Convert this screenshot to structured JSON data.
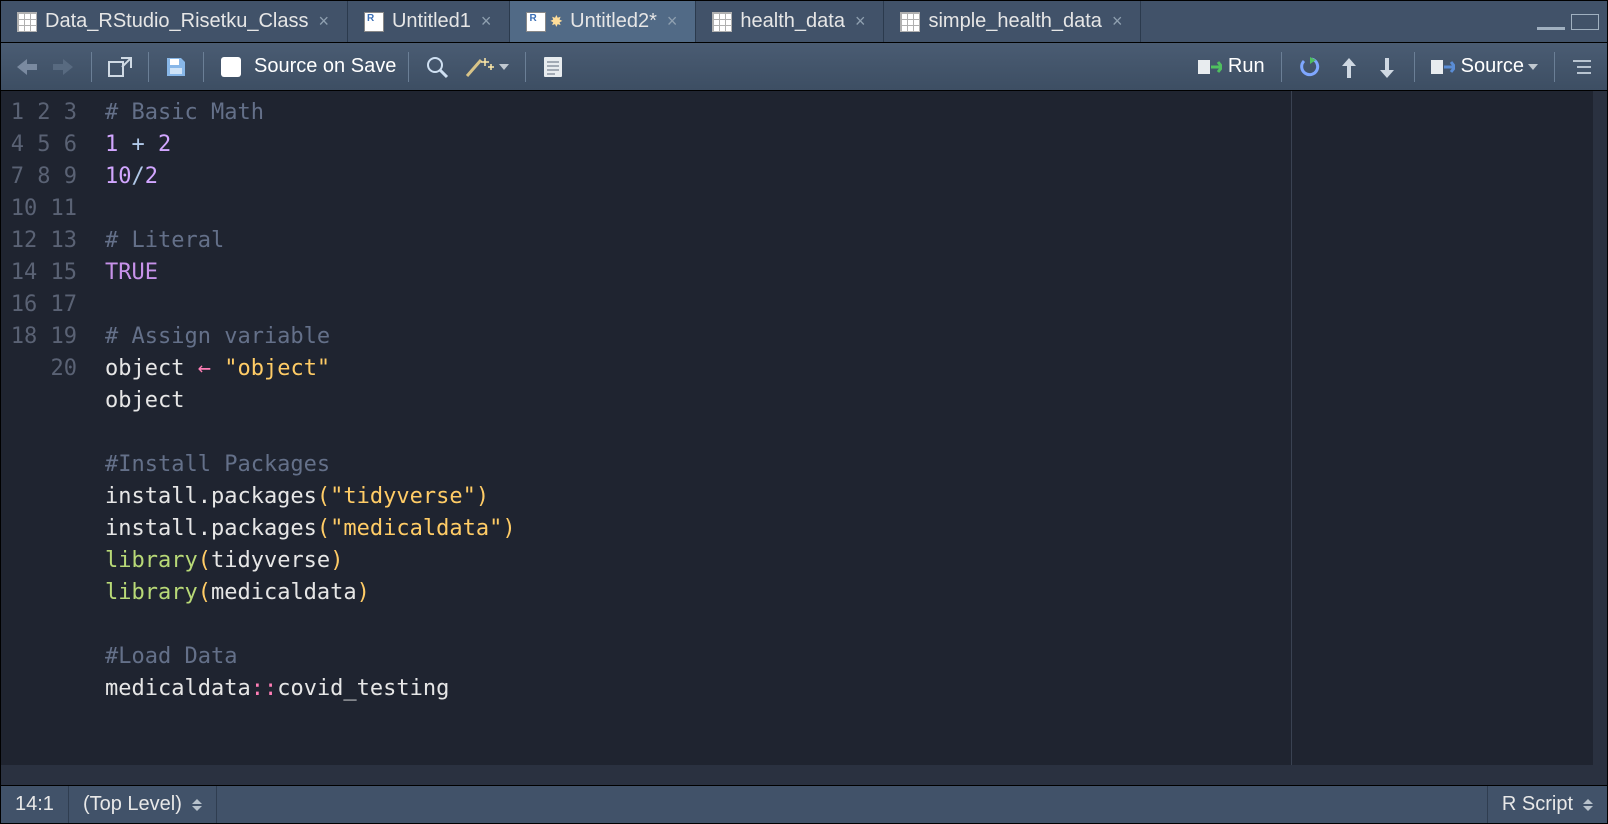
{
  "tabs": [
    {
      "label": "Data_RStudio_Risetku_Class",
      "icon": "table",
      "active": false
    },
    {
      "label": "Untitled1",
      "icon": "rscript",
      "active": false
    },
    {
      "label": "Untitled2*",
      "icon": "rscript-new",
      "active": true
    },
    {
      "label": "health_data",
      "icon": "table",
      "active": false
    },
    {
      "label": "simple_health_data",
      "icon": "table",
      "active": false
    }
  ],
  "toolbar": {
    "source_on_save": "Source on Save",
    "run": "Run",
    "source": "Source"
  },
  "editor": {
    "line_numbers": [
      "1",
      "2",
      "3",
      "4",
      "5",
      "6",
      "7",
      "8",
      "9",
      "10",
      "11",
      "12",
      "13",
      "14",
      "15",
      "16",
      "17",
      "18",
      "19",
      "20"
    ],
    "lines": [
      [
        {
          "t": "comment",
          "v": "# Basic Math"
        }
      ],
      [
        {
          "t": "num",
          "v": "1"
        },
        {
          "t": "op",
          "v": " + "
        },
        {
          "t": "num",
          "v": "2"
        }
      ],
      [
        {
          "t": "num",
          "v": "10"
        },
        {
          "t": "op",
          "v": "/"
        },
        {
          "t": "num",
          "v": "2"
        }
      ],
      [],
      [
        {
          "t": "comment",
          "v": "# Literal"
        }
      ],
      [
        {
          "t": "const",
          "v": "TRUE"
        }
      ],
      [],
      [
        {
          "t": "comment",
          "v": "# Assign variable"
        }
      ],
      [
        {
          "t": "ident",
          "v": "object "
        },
        {
          "t": "assign",
          "v": "← "
        },
        {
          "t": "str",
          "v": "\"object\""
        }
      ],
      [
        {
          "t": "ident",
          "v": "object"
        }
      ],
      [],
      [
        {
          "t": "comment",
          "v": "#Install Packages"
        }
      ],
      [
        {
          "t": "ident",
          "v": "install.packages"
        },
        {
          "t": "paren",
          "v": "("
        },
        {
          "t": "str",
          "v": "\"tidyverse\""
        },
        {
          "t": "paren",
          "v": ")"
        }
      ],
      [
        {
          "t": "ident",
          "v": "install.packages"
        },
        {
          "t": "paren",
          "v": "("
        },
        {
          "t": "str",
          "v": "\"medicaldata\""
        },
        {
          "t": "paren",
          "v": ")"
        }
      ],
      [
        {
          "t": "func",
          "v": "library"
        },
        {
          "t": "paren",
          "v": "("
        },
        {
          "t": "ident",
          "v": "tidyverse"
        },
        {
          "t": "paren",
          "v": ")"
        }
      ],
      [
        {
          "t": "func",
          "v": "library"
        },
        {
          "t": "paren",
          "v": "("
        },
        {
          "t": "ident",
          "v": "medicaldata"
        },
        {
          "t": "paren",
          "v": ")"
        }
      ],
      [],
      [
        {
          "t": "comment",
          "v": "#Load Data"
        }
      ],
      [
        {
          "t": "ident",
          "v": "medicaldata"
        },
        {
          "t": "dbl",
          "v": "::"
        },
        {
          "t": "ident",
          "v": "covid_testing"
        }
      ],
      []
    ]
  },
  "status": {
    "position": "14:1",
    "scope": "(Top Level)",
    "language": "R Script"
  }
}
